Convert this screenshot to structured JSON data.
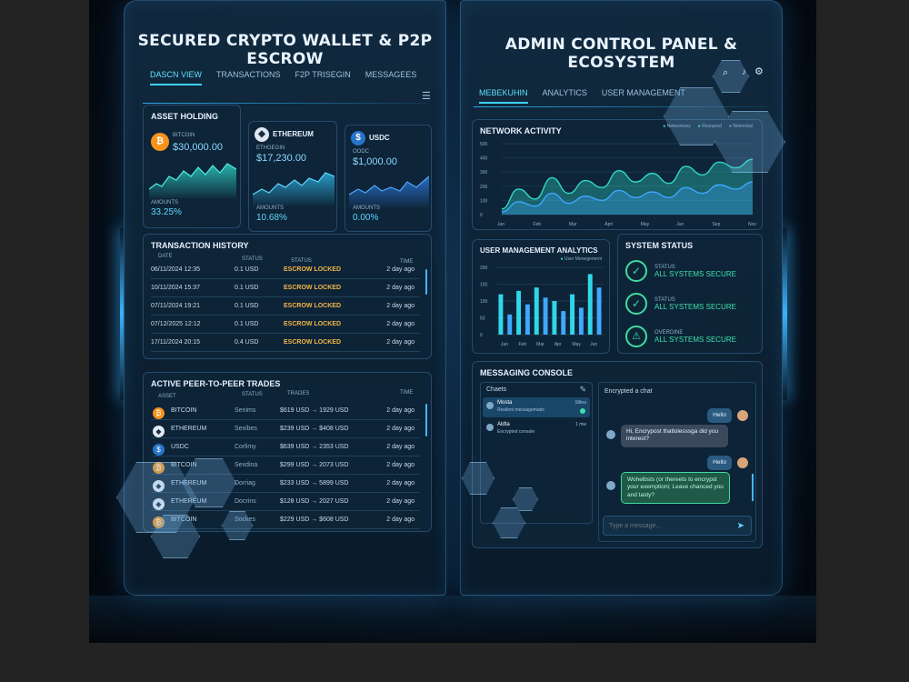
{
  "left": {
    "title": "SECURED CRYPTO WALLET & P2P ESCROW",
    "tabs": [
      "DASCN VIEW",
      "TRANSACTIONS",
      "F2P TRISEGIN",
      "MESSAGEES"
    ],
    "asset": {
      "title": "ASSET HOLDING",
      "coin": "BITCOIN",
      "value": "$30,000.00",
      "amount_label": "AMOUNTS",
      "amount": "33.25%"
    },
    "eth": {
      "name": "ETHEREUM",
      "sub": "ETHGEGIN",
      "value": "$17,230.00",
      "amount_label": "AMOUNTS",
      "amount": "10.68%"
    },
    "usdc": {
      "name": "USDC",
      "sub": "OODC",
      "value": "$1,000.00",
      "amount_label": "AMOUNTS",
      "amount": "0.00%"
    },
    "history": {
      "title": "TRANSACTION HISTORY",
      "headers": [
        "DATE",
        "STATUS",
        "STATUS",
        "TIME"
      ],
      "rows": [
        {
          "date": "06/11/2024 12:35",
          "amount": "0.1 USD",
          "status": "ESCROW LOCKED",
          "time": "2 day ago"
        },
        {
          "date": "10/11/2024 15:37",
          "amount": "0.1 USD",
          "status": "ESCROW LOCKED",
          "time": "2 day ago"
        },
        {
          "date": "07/11/2024 19:21",
          "amount": "0.1 USD",
          "status": "ESCROW LOCKED",
          "time": "2 day ago"
        },
        {
          "date": "07/12/2025 12:12",
          "amount": "0.1 USD",
          "status": "ESCROW LOCKED",
          "time": "2 day ago"
        },
        {
          "date": "17/11/2024 20:15",
          "amount": "0.4 USD",
          "status": "ESCROW LOCKED",
          "time": "2 day ago"
        }
      ]
    },
    "p2p": {
      "title": "ACTIVE PEER-TO-PEER TRADES",
      "headers": [
        "ASSET",
        "STATUS",
        "TRADES",
        "TIME"
      ],
      "rows": [
        {
          "asset": "BITCOIN",
          "status": "Senims",
          "trade": "$619 USD → 1929 USD",
          "time": "2 day ago"
        },
        {
          "asset": "ETHEREUM",
          "status": "Sexibes",
          "trade": "$239 USD → $408 USD",
          "time": "2 day ago"
        },
        {
          "asset": "USDC",
          "status": "Corlimy",
          "trade": "$639 USD → 2353 USD",
          "time": "2 day ago"
        },
        {
          "asset": "BITCOIN",
          "status": "Sexdina",
          "trade": "$299 USD → 2073 USD",
          "time": "2 day ago"
        },
        {
          "asset": "ETHEREUM",
          "status": "Dorriag",
          "trade": "$233 USD → 5899 USD",
          "time": "2 day ago"
        },
        {
          "asset": "ETHEREUM",
          "status": "Docrins",
          "trade": "$128 USD → 2027 USD",
          "time": "2 day ago"
        },
        {
          "asset": "BITCOIN",
          "status": "Sockes",
          "trade": "$229 USD → $608 USD",
          "time": "2 day ago"
        }
      ]
    }
  },
  "right": {
    "title": "ADMIN CONTROL PANEL & ECOSYSTEM",
    "tabs": [
      "MEBEKUHIN",
      "ANALYTICS",
      "USER MANAGEMENT"
    ],
    "network": {
      "title": "NETWORK ACTIVITY",
      "legend": [
        "Networksey",
        "Resopred",
        "Netorobal"
      ],
      "y_ticks": [
        "500",
        "400",
        "300",
        "200",
        "100",
        "0"
      ],
      "x_ticks": [
        "Jan",
        "Feb",
        "Mar",
        "Apri",
        "May",
        "Jun",
        "Sep",
        "Nov"
      ]
    },
    "user_analytics": {
      "title": "USER MANAGEMENT ANALYTICS",
      "legend": "User Menegement",
      "y_ticks": [
        "200",
        "150",
        "100",
        "50",
        "0"
      ],
      "x_ticks": [
        "Jan",
        "Feb",
        "Mar",
        "Apr",
        "May",
        "Jun"
      ]
    },
    "system": {
      "title": "SYSTEM STATUS",
      "items": [
        {
          "label": "STATUS",
          "value": "ALL SYSTEMS SECURE",
          "icon": "✓"
        },
        {
          "label": "STATUS",
          "value": "ALL SYSTEMS SECURE",
          "icon": "✓"
        },
        {
          "label": "OVERDINE",
          "value": "ALL SYSTEMS SECURE",
          "icon": "⚠"
        }
      ]
    },
    "messaging": {
      "title": "MESSAGING CONSOLE",
      "chats_label": "Chaets",
      "contacts": [
        {
          "name": "Mosta",
          "preview": "Resilent messagemadc",
          "meta": "Siltna"
        },
        {
          "name": "Aldta",
          "preview": "Encrypted console",
          "meta": "1 mw"
        }
      ],
      "chat_title": "Encrypted a chat",
      "messages": [
        {
          "from": "me",
          "text": "Hello"
        },
        {
          "from": "them",
          "text": "Hi, Encrypost thatlolesssga did you interest?"
        },
        {
          "from": "me",
          "text": "Hello"
        },
        {
          "from": "them",
          "text": "Wohelbsts (or thereets to encrypst your exemptioni; Leave chanced you and tasty?"
        }
      ],
      "input_placeholder": "Type a message..."
    }
  },
  "colors": {
    "accent": "#3fd0ff",
    "escrow": "#f2b646",
    "secure": "#3fe0a8",
    "bitcoin": "#f7931a",
    "usdc": "#2775ca"
  },
  "chart_data": [
    {
      "type": "line",
      "title": "NETWORK ACTIVITY",
      "x": [
        "Jan",
        "Feb",
        "Mar",
        "Apri",
        "May",
        "Jun",
        "Sep",
        "Nov"
      ],
      "ylim": [
        0,
        500
      ],
      "series": [
        {
          "name": "Networksey",
          "values": [
            40,
            180,
            110,
            260,
            150,
            240,
            190,
            310,
            230,
            290,
            220,
            340,
            280,
            370,
            330,
            390
          ]
        },
        {
          "name": "Resopred",
          "values": [
            20,
            90,
            60,
            150,
            80,
            130,
            100,
            170,
            120,
            160,
            120,
            190,
            150,
            210,
            180,
            230
          ]
        }
      ]
    },
    {
      "type": "bar",
      "title": "USER MANAGEMENT ANALYTICS",
      "categories": [
        "Jan",
        "Feb",
        "Mar",
        "Apr",
        "May",
        "Jun"
      ],
      "ylim": [
        0,
        200
      ],
      "series": [
        {
          "name": "User Menegement",
          "values": [
            120,
            60,
            130,
            90,
            140,
            110,
            100,
            70,
            120,
            80,
            180,
            140
          ]
        }
      ]
    }
  ]
}
